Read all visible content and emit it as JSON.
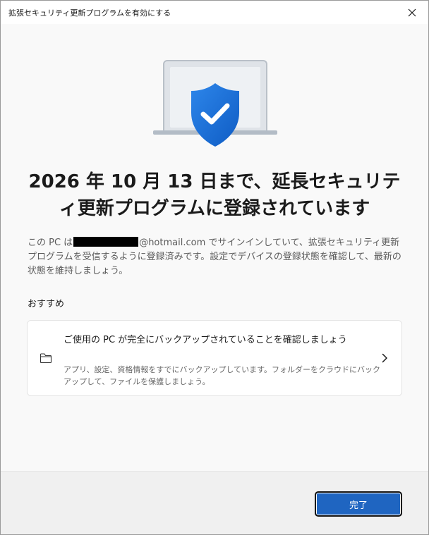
{
  "window": {
    "title": "拡張セキュリティ更新プログラムを有効にする"
  },
  "icons": {
    "close": "close-icon",
    "hero": "laptop-shield-check-icon",
    "card": "folder-icon",
    "chevron": "chevron-right-icon"
  },
  "main": {
    "heading_line1": "2026 年 10 月 13 日まで、延長セキュリテ",
    "heading_line2": "ィ更新プログラムに登録されています",
    "description_prefix": "この PC は",
    "description_suffix": "@hotmail.com でサインインしていて、拡張セキュリティ更新プログラムを受信するように登録済みです。設定でデバイスの登録状態を確認して、最新の状態を維持しましょう。",
    "section_label": "おすすめ"
  },
  "card": {
    "title": "ご使用の PC が完全にバックアップされていることを確認しましょう",
    "description": "アプリ、設定、資格情報をすでにバックアップしています。フォルダーをクラウドにバックアップして、ファイルを保護しましょう。"
  },
  "footer": {
    "done_label": "完了"
  },
  "colors": {
    "accent": "#1f65c1",
    "shield": "#1a6fd6",
    "window_bg": "#f9f9f9",
    "footer_bg": "#f0f0f0"
  }
}
